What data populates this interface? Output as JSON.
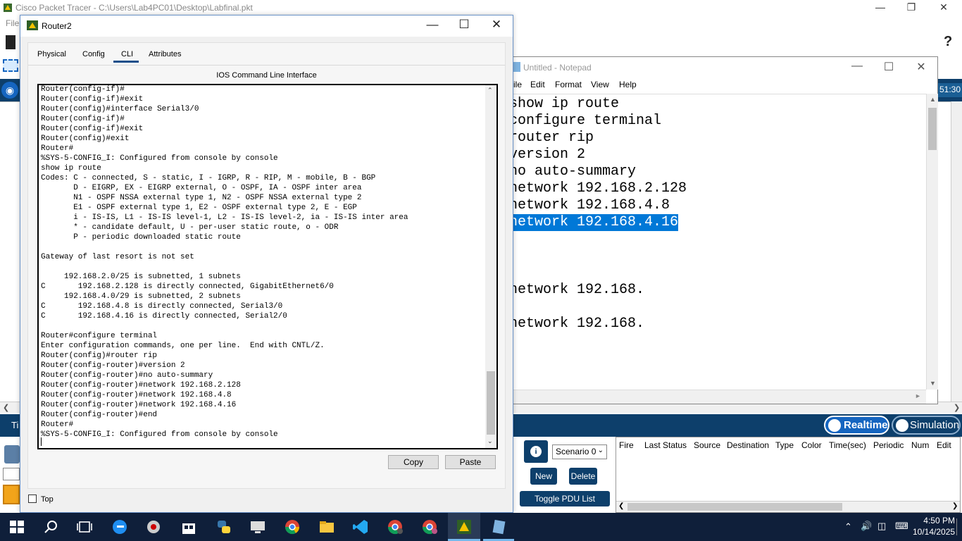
{
  "packet_tracer": {
    "title": "Cisco Packet Tracer - C:\\Users\\Lab4PC01\\Desktop\\Labfinal.pkt",
    "menu_file": "File",
    "help_label": "?",
    "time_partial": "51:30",
    "time_label_left": "Ti",
    "realtime_label": "Realtime",
    "simulation_label": "Simulation",
    "scenario_value": "Scenario 0",
    "new_label": "New",
    "delete_label": "Delete",
    "toggle_pdu_label": "Toggle PDU List Window",
    "info_label": "i",
    "pdu_columns": [
      "Fire",
      "Last Status",
      "Source",
      "Destination",
      "Type",
      "Color",
      "Time(sec)",
      "Periodic",
      "Num",
      "Edit"
    ]
  },
  "notepad": {
    "title": "Untitled - Notepad",
    "menus": [
      "ile",
      "Edit",
      "Format",
      "View",
      "Help"
    ],
    "lines": [
      "show ip route",
      "configure terminal",
      "router rip",
      "version 2",
      "no auto-summary",
      "network 192.168.2.128",
      "network 192.168.4.8",
      "network 192.168.4.16",
      "",
      "",
      "",
      "network 192.168.",
      "",
      "network 192.168."
    ],
    "selected_line_index": 7
  },
  "router_window": {
    "title": "Router2",
    "tabs": [
      "Physical",
      "Config",
      "CLI",
      "Attributes"
    ],
    "active_tab": "CLI",
    "cli_heading": "IOS Command Line Interface",
    "copy_label": "Copy",
    "paste_label": "Paste",
    "top_label": "Top",
    "cli_lines": [
      "Router(config-if)#",
      "Router(config-if)#exit",
      "Router(config)#interface Serial3/0",
      "Router(config-if)#",
      "Router(config-if)#exit",
      "Router(config)#exit",
      "Router#",
      "%SYS-5-CONFIG_I: Configured from console by console",
      "show ip route",
      "Codes: C - connected, S - static, I - IGRP, R - RIP, M - mobile, B - BGP",
      "       D - EIGRP, EX - EIGRP external, O - OSPF, IA - OSPF inter area",
      "       N1 - OSPF NSSA external type 1, N2 - OSPF NSSA external type 2",
      "       E1 - OSPF external type 1, E2 - OSPF external type 2, E - EGP",
      "       i - IS-IS, L1 - IS-IS level-1, L2 - IS-IS level-2, ia - IS-IS inter area",
      "       * - candidate default, U - per-user static route, o - ODR",
      "       P - periodic downloaded static route",
      "",
      "Gateway of last resort is not set",
      "",
      "     192.168.2.0/25 is subnetted, 1 subnets",
      "C       192.168.2.128 is directly connected, GigabitEthernet6/0",
      "     192.168.4.0/29 is subnetted, 2 subnets",
      "C       192.168.4.8 is directly connected, Serial3/0",
      "C       192.168.4.16 is directly connected, Serial2/0",
      "",
      "Router#configure terminal",
      "Enter configuration commands, one per line.  End with CNTL/Z.",
      "Router(config)#router rip",
      "Router(config-router)#version 2",
      "Router(config-router)#no auto-summary",
      "Router(config-router)#network 192.168.2.128",
      "Router(config-router)#network 192.168.4.8",
      "Router(config-router)#network 192.168.4.16",
      "Router(config-router)#end",
      "Router#",
      "%SYS-5-CONFIG_I: Configured from console by console"
    ]
  },
  "taskbar": {
    "time": "4:50 PM",
    "date": "10/14/2025",
    "apps": [
      "start-icon",
      "search-icon",
      "task-view-icon",
      "edge-icon",
      "network-tool-icon",
      "store-icon",
      "python-icon",
      "remote-desktop-icon",
      "chrome-icon",
      "file-explorer-icon",
      "vscode-icon",
      "chrome-profile-icon",
      "chrome-profile2-icon",
      "packet-tracer-icon",
      "notepad-icon"
    ]
  }
}
